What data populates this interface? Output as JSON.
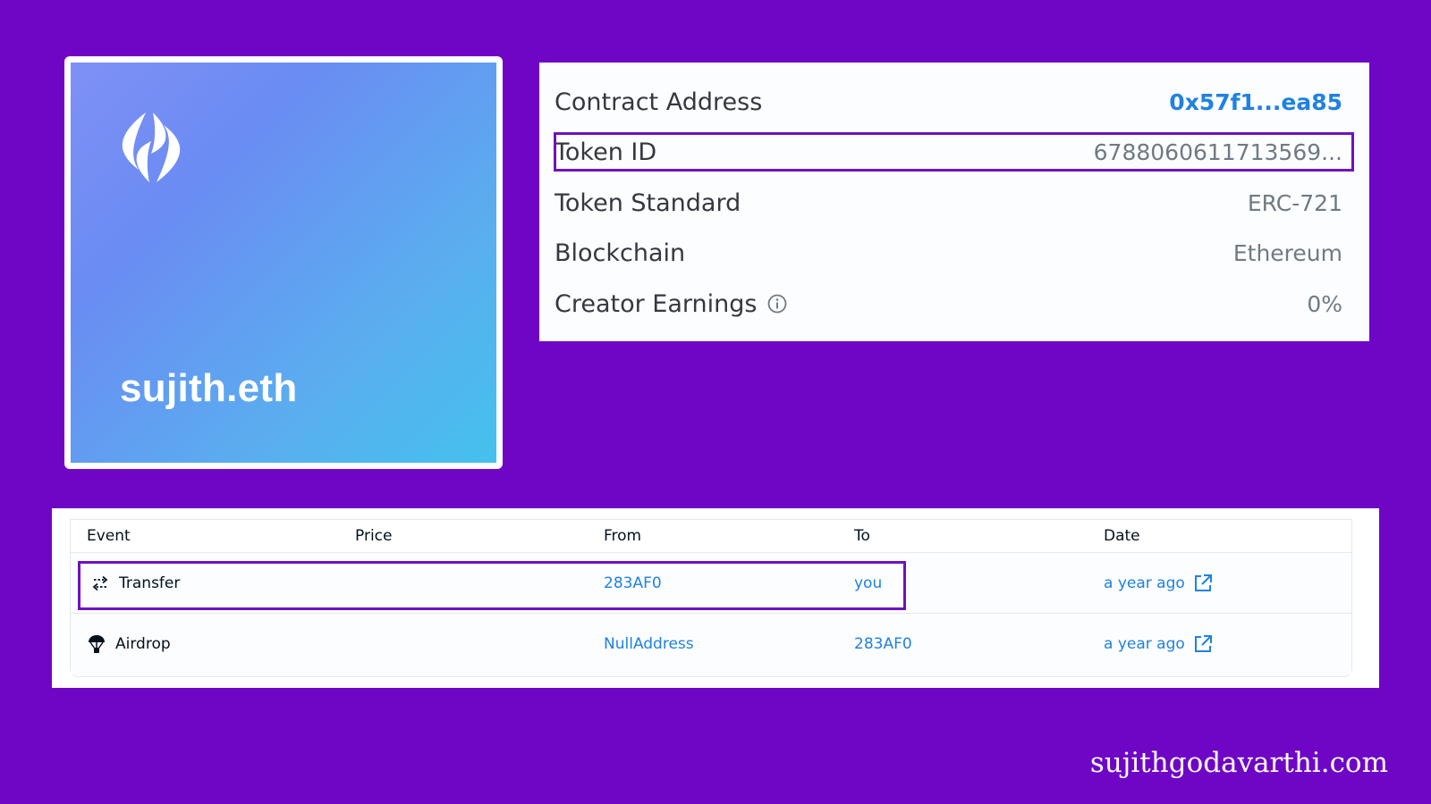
{
  "nft": {
    "name": "sujith.eth",
    "logo_icon": "ens-logo-icon",
    "colors": {
      "gradient_start": "#7f90f6",
      "gradient_end": "#44c1ed"
    }
  },
  "details": {
    "contract_address": {
      "label": "Contract Address",
      "value": "0x57f1...ea85"
    },
    "token_id": {
      "label": "Token ID",
      "value": "6788060611713569..."
    },
    "token_standard": {
      "label": "Token Standard",
      "value": "ERC-721"
    },
    "blockchain": {
      "label": "Blockchain",
      "value": "Ethereum"
    },
    "creator_earnings": {
      "label": "Creator Earnings",
      "value": "0%",
      "icon": "info-icon"
    }
  },
  "activity": {
    "columns": [
      "Event",
      "Price",
      "From",
      "To",
      "Date"
    ],
    "rows": [
      {
        "event": "Transfer",
        "event_icon": "transfer-icon",
        "price": "",
        "from": "283AF0",
        "to": "you",
        "date": "a year ago",
        "date_icon": "external-link-icon"
      },
      {
        "event": "Airdrop",
        "event_icon": "airdrop-icon",
        "price": "",
        "from": "NullAddress",
        "to": "283AF0",
        "date": "a year ago",
        "date_icon": "external-link-icon"
      }
    ]
  },
  "watermark": "sujithgodavarthi.com",
  "colors": {
    "background": "#6f06c6",
    "highlight": "#6e12bf",
    "link": "#2081e2"
  }
}
